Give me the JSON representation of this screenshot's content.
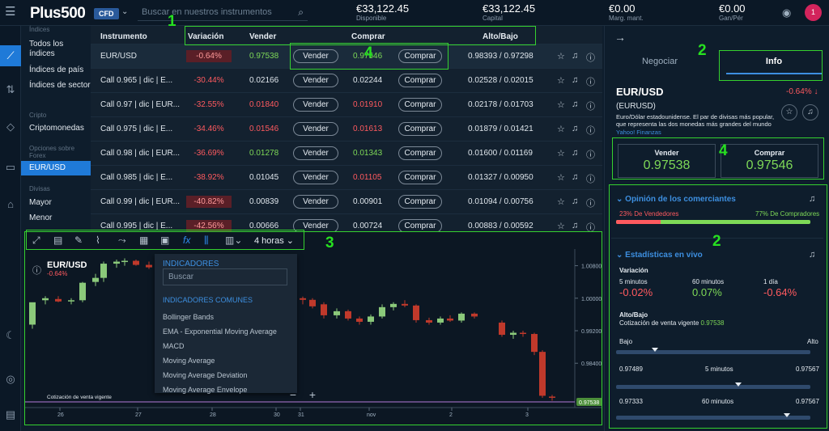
{
  "topbar": {
    "logo": "Plus500",
    "mode": "CFD",
    "search_placeholder": "Buscar en nuestros instrumentos",
    "stats": [
      {
        "value": "€33,122.45",
        "label": "Disponible"
      },
      {
        "value": "€33,122.45",
        "label": "Capital"
      },
      {
        "value": "€0.00",
        "label": "Marg. mant."
      },
      {
        "value": "€0.00",
        "label": "Gan/Pér"
      }
    ],
    "notifications": "1"
  },
  "categories": {
    "section_indices": "Índices",
    "items_indices": [
      "Todos los índices",
      "Índices de país",
      "Índices de sector"
    ],
    "section_crypto": "Cripto",
    "crypto": "Criptomonedas",
    "section_forex": "Opciones sobre Forex",
    "forex_selected": "EUR/USD",
    "section_divisas": "Divisas",
    "divisas": [
      "Mayor",
      "Menor"
    ]
  },
  "table": {
    "headers": {
      "instrument": "Instrumento",
      "change": "Variación",
      "sell": "Vender",
      "buy": "Comprar",
      "range": "Alto/Bajo"
    },
    "sell_label": "Vender",
    "buy_label": "Comprar",
    "rows": [
      {
        "name": "EUR/USD",
        "change": "-0.64%",
        "sell": "0.97538",
        "buy": "0.97546",
        "range": "0.98393 / 0.97298"
      },
      {
        "name": "Call 0.965 | dic | E...",
        "change": "-30.44%",
        "sell": "0.02166",
        "buy": "0.02244",
        "range": "0.02528 / 0.02015"
      },
      {
        "name": "Call 0.97 | dic | EUR...",
        "change": "-32.55%",
        "sell": "0.01840",
        "buy": "0.01910",
        "range": "0.02178 / 0.01703"
      },
      {
        "name": "Call 0.975 | dic | E...",
        "change": "-34.46%",
        "sell": "0.01546",
        "buy": "0.01613",
        "range": "0.01879 / 0.01421"
      },
      {
        "name": "Call 0.98 | dic | EUR...",
        "change": "-36.69%",
        "sell": "0.01278",
        "buy": "0.01343",
        "range": "0.01600 / 0.01169"
      },
      {
        "name": "Call 0.985 | dic | E...",
        "change": "-38.92%",
        "sell": "0.01045",
        "buy": "0.01105",
        "range": "0.01327 / 0.00950"
      },
      {
        "name": "Call 0.99 | dic | EUR...",
        "change": "-40.82%",
        "sell": "0.00839",
        "buy": "0.00901",
        "range": "0.01094 / 0.00756"
      },
      {
        "name": "Call 0.995 | dic | E...",
        "change": "-42.56%",
        "sell": "0.00666",
        "buy": "0.00724",
        "range": "0.00883 / 0.00592"
      }
    ]
  },
  "chart": {
    "timeframe": "4 horas",
    "symbol": "EUR/USD",
    "change": "-0.64%",
    "price_line_label": "Cotización de venta vigente",
    "price_tag": "0.97538",
    "y_ticks": [
      "1.00800",
      "1.00000",
      "0.99200",
      "0.98400"
    ],
    "x_ticks": [
      "26",
      "27",
      "28",
      "30",
      "31",
      "nov",
      "2",
      "3"
    ],
    "colors": {
      "up": "#8bc97a",
      "down": "#c0392b"
    }
  },
  "indicators": {
    "header": "INDICADORES",
    "search": "Buscar",
    "common_header": "INDICADORES COMUNES",
    "items": [
      "Bollinger Bands",
      "EMA - Exponential Moving Average",
      "MACD",
      "Moving Average",
      "Moving Average Deviation",
      "Moving Average Envelope"
    ]
  },
  "right": {
    "tab_trade": "Negociar",
    "tab_info": "Info",
    "symbol": "EUR/USD",
    "change": "-0.64%",
    "code": "(EURUSD)",
    "description": "Euro/Dólar estadounidense. El par de divisas más popular, que representa las dos monedas más grandes del mundo",
    "link": "Yahoo! Finanzas",
    "sell_label": "Vender",
    "sell_value": "0.97538",
    "buy_label": "Comprar",
    "buy_value": "0.97546",
    "sentiment_header": "Opinión de los comerciantes",
    "sellers": "23% De Vendedores",
    "buyers": "77% De Compradores",
    "sellers_pct": 23,
    "live_header": "Estadísticas en vivo",
    "variation_label": "Variación",
    "stats": [
      {
        "label": "5 minutos",
        "value": "-0.02%",
        "color": "#ff5a5f"
      },
      {
        "label": "60 minutos",
        "value": "0.07%",
        "color": "#7ed957"
      },
      {
        "label": "1 día",
        "value": "-0.64%",
        "color": "#ff5a5f"
      }
    ],
    "highlow_label": "Alto/Bajo",
    "current_sell_label": "Cotización de venta vigente",
    "current_sell_value": "0.97538",
    "low_label": "Bajo",
    "high_label": "Alto",
    "range_5m": {
      "low": "0.97489",
      "label": "5 minutos",
      "high": "0.97567",
      "pos": 0.63
    },
    "range_60m": {
      "low": "0.97333",
      "label": "60 minutos",
      "high": "0.97567",
      "pos": 0.88
    },
    "range_day_pos": 0.2
  },
  "annotations": [
    "1",
    "2",
    "2",
    "3",
    "4",
    "4"
  ]
}
